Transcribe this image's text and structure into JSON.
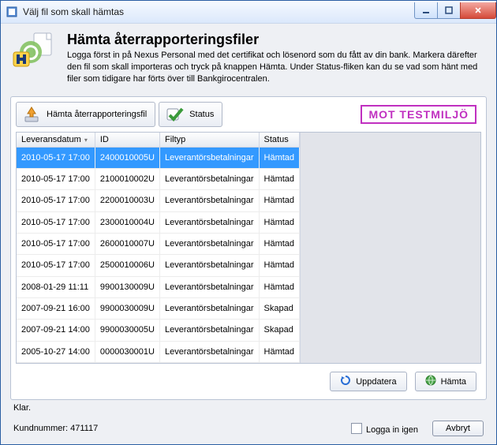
{
  "window": {
    "title": "Välj fil som skall hämtas"
  },
  "header": {
    "title": "Hämta återrapporteringsfiler",
    "description": "Logga först in på Nexus Personal med det certifikat och lösenord som du fått av din bank. Markera därefter den fil som skall importeras och tryck på knappen Hämta. Under Status-fliken kan du se vad som hänt med filer som tidigare har förts över till Bankgirocentralen."
  },
  "tabs": {
    "fetch": "Hämta återrapporteringsfil",
    "status": "Status"
  },
  "stamp": "MOT TESTMILJÖ",
  "columns": {
    "date": "Leveransdatum",
    "id": "ID",
    "type": "Filtyp",
    "status": "Status"
  },
  "rows": [
    {
      "date": "2010-05-17 17:00",
      "id": "2400010005U",
      "type": "Leverantörsbetalningar",
      "status": "Hämtad",
      "selected": true
    },
    {
      "date": "2010-05-17 17:00",
      "id": "2100010002U",
      "type": "Leverantörsbetalningar",
      "status": "Hämtad"
    },
    {
      "date": "2010-05-17 17:00",
      "id": "2200010003U",
      "type": "Leverantörsbetalningar",
      "status": "Hämtad"
    },
    {
      "date": "2010-05-17 17:00",
      "id": "2300010004U",
      "type": "Leverantörsbetalningar",
      "status": "Hämtad"
    },
    {
      "date": "2010-05-17 17:00",
      "id": "2600010007U",
      "type": "Leverantörsbetalningar",
      "status": "Hämtad"
    },
    {
      "date": "2010-05-17 17:00",
      "id": "2500010006U",
      "type": "Leverantörsbetalningar",
      "status": "Hämtad"
    },
    {
      "date": "2008-01-29 11:11",
      "id": "9900130009U",
      "type": "Leverantörsbetalningar",
      "status": "Hämtad"
    },
    {
      "date": "2007-09-21 16:00",
      "id": "9900030009U",
      "type": "Leverantörsbetalningar",
      "status": "Skapad"
    },
    {
      "date": "2007-09-21 14:00",
      "id": "9900030005U",
      "type": "Leverantörsbetalningar",
      "status": "Skapad"
    },
    {
      "date": "2005-10-27 14:00",
      "id": "0000030001U",
      "type": "Leverantörsbetalningar",
      "status": "Hämtad"
    }
  ],
  "buttons": {
    "refresh": "Uppdatera",
    "fetch": "Hämta",
    "cancel": "Avbryt"
  },
  "status_text": "Klar.",
  "customer_label": "Kundnummer: 471117",
  "relogin_label": "Logga in igen"
}
